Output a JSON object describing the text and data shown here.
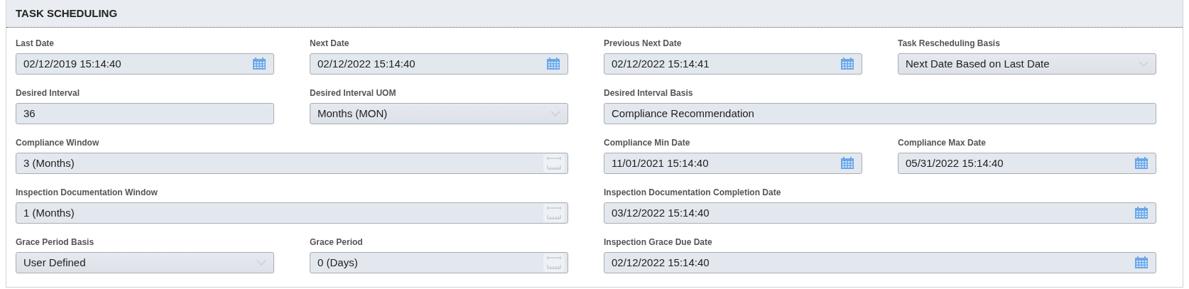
{
  "section": {
    "title": "TASK SCHEDULING"
  },
  "rows": [
    [
      {
        "label": "Last Date",
        "kind": "date",
        "value": "02/12/2019 15:14:40",
        "wide": false
      },
      {
        "label": "Next Date",
        "kind": "date",
        "value": "02/12/2022 15:14:40",
        "wide": false
      },
      {
        "label": "Previous Next Date",
        "kind": "date",
        "value": "02/12/2022 15:14:41",
        "wide": false
      },
      {
        "label": "Task Rescheduling Basis",
        "kind": "select",
        "value": "Next Date Based on Last Date",
        "wide": false
      }
    ],
    [
      {
        "label": "Desired Interval",
        "kind": "text",
        "value": "36",
        "wide": false
      },
      {
        "label": "Desired Interval UOM",
        "kind": "select",
        "value": "Months (MON)",
        "wide": false
      },
      {
        "label": "Desired Interval Basis",
        "kind": "text",
        "value": "Compliance Recommendation",
        "wide": true
      }
    ],
    [
      {
        "label": "Compliance Window",
        "kind": "duration",
        "value": "3 (Months)",
        "wide": true
      },
      {
        "label": "Compliance Min Date",
        "kind": "date",
        "value": "11/01/2021 15:14:40",
        "wide": false
      },
      {
        "label": "Compliance Max Date",
        "kind": "date",
        "value": "05/31/2022 15:14:40",
        "wide": false
      }
    ],
    [
      {
        "label": "Inspection Documentation Window",
        "kind": "duration",
        "value": "1 (Months)",
        "wide": true
      },
      {
        "label": "Inspection Documentation Completion Date",
        "kind": "date",
        "value": "03/12/2022 15:14:40",
        "wide": true
      }
    ],
    [
      {
        "label": "Grace Period Basis",
        "kind": "select",
        "value": "User Defined",
        "wide": false
      },
      {
        "label": "Grace Period",
        "kind": "duration",
        "value": "0 (Days)",
        "wide": false
      },
      {
        "label": "Inspection Grace Due Date",
        "kind": "date",
        "value": "02/12/2022 15:14:40",
        "wide": true
      }
    ]
  ]
}
